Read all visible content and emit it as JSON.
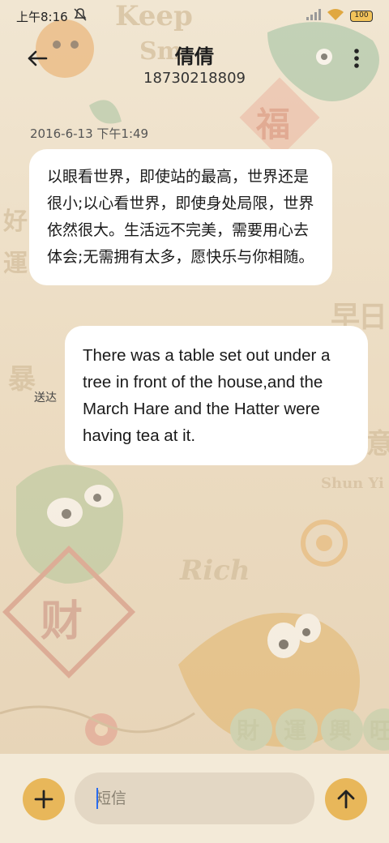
{
  "status_bar": {
    "time": "上午8:16",
    "battery": "100"
  },
  "header": {
    "contact_name": "倩倩",
    "phone_number": "18730218809"
  },
  "conversation": {
    "timestamp": "2016-6-13 下午1:49",
    "messages": [
      {
        "direction": "incoming",
        "text": "以眼看世界，即使站的最高，世界还是很小;以心看世界，即使身处局限，世界依然很大。生活远不完美，需要用心去体会;无需拥有太多，愿快乐与你相随。"
      },
      {
        "direction": "outgoing",
        "text": "There was a table set out under a tree in front of the house,and the March Hare and the Hatter were having tea at it.",
        "status": "送达"
      }
    ]
  },
  "composer": {
    "placeholder": "短信"
  },
  "wallpaper": {
    "texts": [
      "Keep",
      "Sm",
      "福",
      "财",
      "Rich",
      "Shun Yi",
      "財",
      "運",
      "興",
      "旺",
      "早",
      "日",
      "好",
      "運",
      "暴",
      "意"
    ]
  },
  "colors": {
    "accent": "#e8b75a",
    "bubble": "#ffffff",
    "background": "#eadcc4"
  },
  "icons": {
    "back": "arrow-left-icon",
    "more": "more-vertical-icon",
    "add": "plus-icon",
    "send": "arrow-up-icon"
  }
}
